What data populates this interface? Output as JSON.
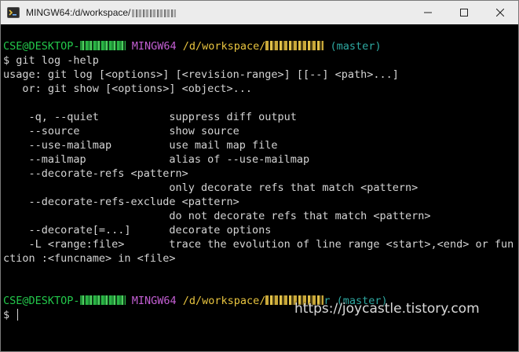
{
  "window": {
    "title": "MINGW64:/d/workspace/",
    "icon": "mingw-terminal-icon",
    "controls": [
      "minimize-icon",
      "maximize-icon",
      "close-icon"
    ]
  },
  "terminal": {
    "prompt1": {
      "user": "CSE@DESKTOP-",
      "shell": "MINGW64",
      "path": "/d/workspace/",
      "branch": "(master)"
    },
    "command": "$ git log -help",
    "output": [
      "usage: git log [<options>] [<revision-range>] [[--] <path>...]",
      "   or: git show [<options>] <object>...",
      "",
      "    -q, --quiet           suppress diff output",
      "    --source              show source",
      "    --use-mailmap         use mail map file",
      "    --mailmap             alias of --use-mailmap",
      "    --decorate-refs <pattern>",
      "                          only decorate refs that match <pattern>",
      "    --decorate-refs-exclude <pattern>",
      "                          do not decorate refs that match <pattern>",
      "    --decorate[=...]      decorate options",
      "    -L <range:file>       trace the evolution of line range <start>,<end> or fun",
      "ction :<funcname> in <file>",
      "",
      ""
    ],
    "prompt2": {
      "user": "CSE@DESKTOP-",
      "shell": "MINGW64",
      "path": "/d/workspace/",
      "branch_tail": "r (master)"
    },
    "prompt_symbol": "$"
  },
  "watermark": "https://joycastle.tistory.com"
}
